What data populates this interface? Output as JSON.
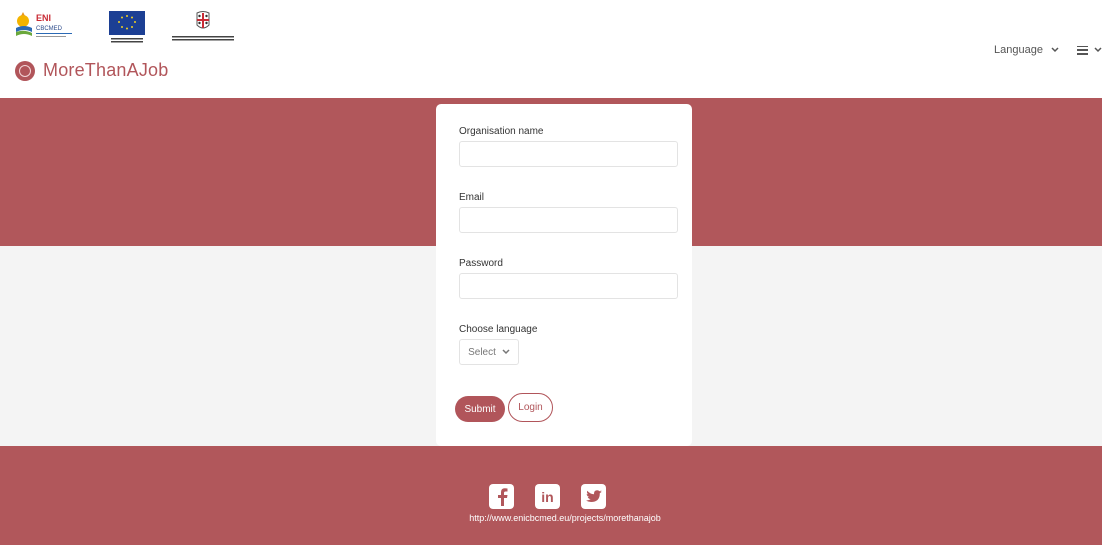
{
  "header": {
    "logos": {
      "eni_text": "ENI",
      "eni_sub": "CBCMED",
      "eu_caption": "Project funded by the EUROPEAN UNION",
      "region_caption": "REGIONE AUTONOMA DE SARDIGNA"
    },
    "brand": {
      "name": "MoreThanAJob"
    },
    "language_menu": {
      "label": "Language",
      "icon": "chevron-down-icon"
    },
    "menu_icon": "hamburger-menu-icon"
  },
  "form": {
    "organisation_label": "Organisation name",
    "organisation_value": "",
    "email_label": "Email",
    "email_value": "",
    "password_label": "Password",
    "password_value": "",
    "language_label": "Choose language",
    "language_select": {
      "selected": "Select",
      "icon": "chevron-down-icon"
    },
    "submit_label": "Submit",
    "login_label": "Login"
  },
  "footer": {
    "social": [
      {
        "name": "facebook",
        "glyph": "f"
      },
      {
        "name": "linkedin",
        "glyph": "in"
      },
      {
        "name": "twitter",
        "glyph": "t"
      }
    ],
    "link": "http://www.enicbcmed.eu/projects/morethanajob"
  },
  "colors": {
    "brand": "#b1555a",
    "band": "#b1575b",
    "page_bg": "#f4f4f4",
    "card_bg": "#ffffff"
  }
}
